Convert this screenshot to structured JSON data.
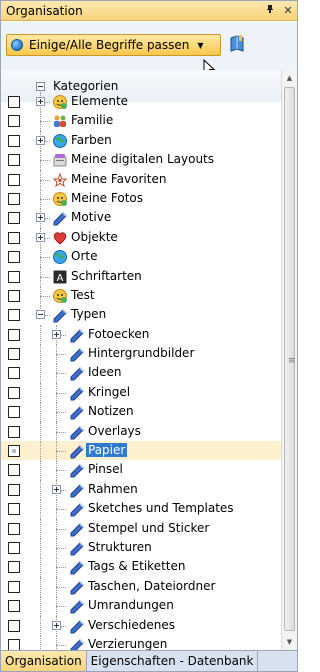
{
  "panel": {
    "title": "Organisation",
    "pin_glyph": "ᵖ",
    "close_glyph": "✕"
  },
  "toolbar": {
    "filter_label": "Einige/Alle Begriffe passen",
    "filter_icon": "globe-icon",
    "book_icon": "book-icon"
  },
  "tree": {
    "root_label": "Kategorien",
    "items": [
      {
        "label": "Elemente",
        "level": 1,
        "expander": "plus",
        "icon": "smiley",
        "checkbox": "empty",
        "selected": false
      },
      {
        "label": "Familie",
        "level": 1,
        "expander": "none",
        "icon": "family",
        "checkbox": "empty",
        "selected": false
      },
      {
        "label": "Farben",
        "level": 1,
        "expander": "plus",
        "icon": "globe",
        "checkbox": "empty",
        "selected": false
      },
      {
        "label": "Meine digitalen Layouts",
        "level": 1,
        "expander": "none",
        "icon": "layout",
        "checkbox": "empty",
        "selected": false
      },
      {
        "label": "Meine Favoriten",
        "level": 1,
        "expander": "none",
        "icon": "favorite",
        "checkbox": "empty",
        "selected": false
      },
      {
        "label": "Meine Fotos",
        "level": 1,
        "expander": "none",
        "icon": "smiley",
        "checkbox": "empty",
        "selected": false
      },
      {
        "label": "Motive",
        "level": 1,
        "expander": "plus",
        "icon": "pen",
        "checkbox": "empty",
        "selected": false
      },
      {
        "label": "Objekte",
        "level": 1,
        "expander": "plus",
        "icon": "heart",
        "checkbox": "empty",
        "selected": false
      },
      {
        "label": "Orte",
        "level": 1,
        "expander": "none",
        "icon": "globe",
        "checkbox": "empty",
        "selected": false
      },
      {
        "label": "Schriftarten",
        "level": 1,
        "expander": "none",
        "icon": "font",
        "checkbox": "empty",
        "selected": false
      },
      {
        "label": "Test",
        "level": 1,
        "expander": "none",
        "icon": "smiley",
        "checkbox": "empty",
        "selected": false
      },
      {
        "label": "Typen",
        "level": 1,
        "expander": "minus",
        "icon": "pen",
        "checkbox": "empty",
        "selected": false
      },
      {
        "label": "Fotoecken",
        "level": 2,
        "expander": "plus",
        "icon": "pen",
        "checkbox": "empty",
        "selected": false
      },
      {
        "label": "Hintergrundbilder",
        "level": 2,
        "expander": "none",
        "icon": "pen",
        "checkbox": "empty",
        "selected": false
      },
      {
        "label": "Ideen",
        "level": 2,
        "expander": "none",
        "icon": "pen",
        "checkbox": "empty",
        "selected": false
      },
      {
        "label": "Kringel",
        "level": 2,
        "expander": "none",
        "icon": "pen",
        "checkbox": "empty",
        "selected": false
      },
      {
        "label": "Notizen",
        "level": 2,
        "expander": "none",
        "icon": "pen",
        "checkbox": "empty",
        "selected": false
      },
      {
        "label": "Overlays",
        "level": 2,
        "expander": "none",
        "icon": "pen",
        "checkbox": "empty",
        "selected": false
      },
      {
        "label": "Papier",
        "level": 2,
        "expander": "none",
        "icon": "pen",
        "checkbox": "indeterminate",
        "selected": true
      },
      {
        "label": "Pinsel",
        "level": 2,
        "expander": "none",
        "icon": "pen",
        "checkbox": "empty",
        "selected": false
      },
      {
        "label": "Rahmen",
        "level": 2,
        "expander": "plus",
        "icon": "pen",
        "checkbox": "empty",
        "selected": false
      },
      {
        "label": "Sketches und Templates",
        "level": 2,
        "expander": "none",
        "icon": "pen",
        "checkbox": "empty",
        "selected": false
      },
      {
        "label": "Stempel und Sticker",
        "level": 2,
        "expander": "none",
        "icon": "pen",
        "checkbox": "empty",
        "selected": false
      },
      {
        "label": "Strukturen",
        "level": 2,
        "expander": "none",
        "icon": "pen",
        "checkbox": "empty",
        "selected": false
      },
      {
        "label": "Tags & Etiketten",
        "level": 2,
        "expander": "none",
        "icon": "pen",
        "checkbox": "empty",
        "selected": false
      },
      {
        "label": "Taschen, Dateiordner",
        "level": 2,
        "expander": "none",
        "icon": "pen",
        "checkbox": "empty",
        "selected": false
      },
      {
        "label": "Umrandungen",
        "level": 2,
        "expander": "none",
        "icon": "pen",
        "checkbox": "empty",
        "selected": false
      },
      {
        "label": "Verschiedenes",
        "level": 2,
        "expander": "plus",
        "icon": "pen",
        "checkbox": "empty",
        "selected": false
      },
      {
        "label": "Verzierungen",
        "level": 2,
        "expander": "none",
        "icon": "pen",
        "checkbox": "empty",
        "selected": false
      }
    ]
  },
  "tabs": [
    {
      "label": "Organisation",
      "active": true
    },
    {
      "label": "Eigenschaften - Datenbank",
      "active": false
    }
  ],
  "colors": {
    "accent": "#f8d37c",
    "selection": "#3079d2",
    "selected_row": "#fdf0cf"
  }
}
